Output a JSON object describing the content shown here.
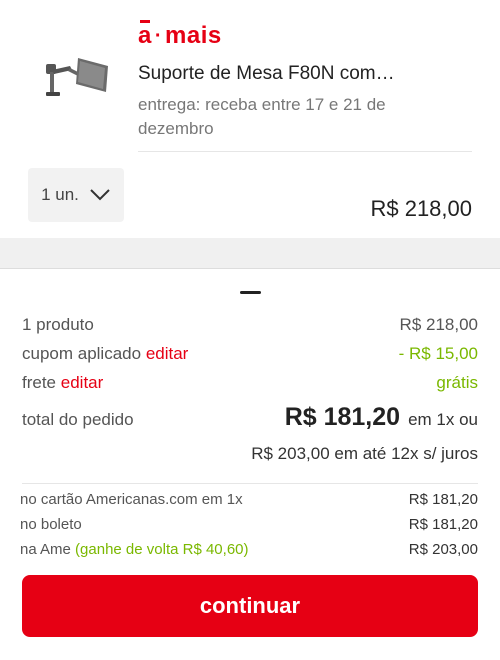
{
  "brand": {
    "prefix": "a",
    "dot": "·",
    "name": "mais"
  },
  "product": {
    "name": "Suporte de Mesa F80N com…",
    "delivery": "entrega: receba entre 17 e 21 de dezembro",
    "qty_label": "1 un.",
    "price": "R$ 218,00"
  },
  "summary": {
    "products_label": "1 produto",
    "products_value": "R$ 218,00",
    "coupon_label": "cupom aplicado",
    "coupon_edit": "editar",
    "coupon_value": "- R$ 15,00",
    "shipping_label": "frete",
    "shipping_edit": "editar",
    "shipping_value": "grátis",
    "total_label": "total do pedido",
    "total_value": "R$ 181,20",
    "total_suffix": "em 1x ou",
    "installment_text": "R$ 203,00 em até 12x s/ juros"
  },
  "payment_options": [
    {
      "label": "no cartão Americanas.com em 1x",
      "highlight": "",
      "value": "R$ 181,20"
    },
    {
      "label": "no boleto",
      "highlight": "",
      "value": "R$ 181,20"
    },
    {
      "label": "na Ame",
      "highlight": "(ganhe de volta R$ 40,60)",
      "value": "R$ 203,00"
    }
  ],
  "continue_label": "continuar",
  "colors": {
    "accent": "#e60014",
    "green": "#7ab800"
  },
  "icons": {
    "qty": "chevron-down-icon"
  }
}
